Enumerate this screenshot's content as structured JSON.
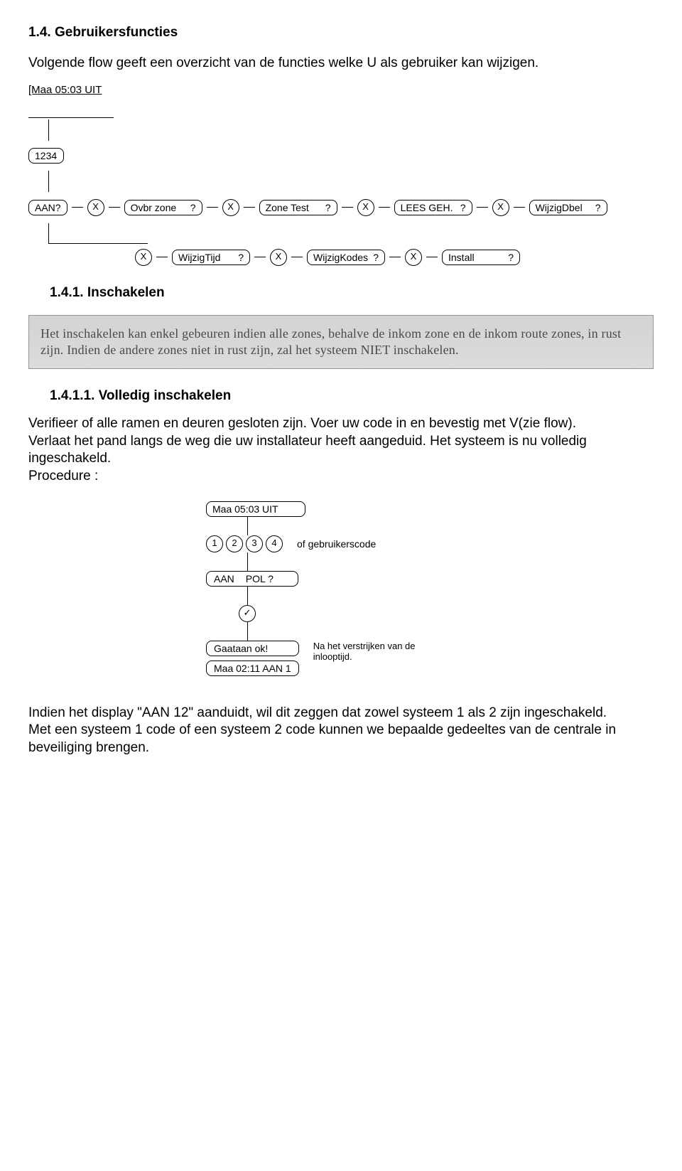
{
  "section": {
    "heading": "1.4. Gebruikersfuncties",
    "intro": "Volgende flow geeft een overzicht van de functies welke U als gebruiker kan wijzigen.",
    "status_line": "[Maa 05:03 UIT",
    "diagram1": {
      "code_box": "1234",
      "row1": [
        {
          "type": "pill",
          "label": "AAN?",
          "q": ""
        },
        {
          "type": "key",
          "label": "X"
        },
        {
          "type": "pill",
          "label": "Ovbr  zone",
          "q": "?"
        },
        {
          "type": "key",
          "label": "X"
        },
        {
          "type": "pill",
          "label": "Zone Test",
          "q": "?"
        },
        {
          "type": "key",
          "label": "X"
        },
        {
          "type": "pill",
          "label": "LEES GEH.",
          "q": "?"
        },
        {
          "type": "key",
          "label": "X"
        },
        {
          "type": "pill",
          "label": "WijzigDbel",
          "q": "?"
        }
      ],
      "row2": [
        {
          "type": "key",
          "label": "X"
        },
        {
          "type": "pill",
          "label": "WijzigTijd",
          "q": "?"
        },
        {
          "type": "key",
          "label": "X"
        },
        {
          "type": "pill",
          "label": "WijzigKodes",
          "q": "?"
        },
        {
          "type": "key",
          "label": "X"
        },
        {
          "type": "pill",
          "label": "Install",
          "q": "?"
        }
      ]
    },
    "sub1": {
      "heading": "1.4.1. Inschakelen",
      "greybox": "Het inschakelen kan enkel gebeuren indien alle zones, behalve de inkom zone en de inkom route zones, in rust zijn. Indien de andere zones niet in rust zijn, zal het systeem NIET inschakelen.",
      "sub": {
        "heading": "1.4.1.1. Volledig inschakelen",
        "para": "Verifieer of alle ramen en deuren gesloten zijn. Voer uw code in en bevestig met V(zie flow).\nVerlaat het pand langs de weg die uw installateur heeft aangeduid. Het systeem is nu volledig ingeschakeld.\nProcedure :"
      }
    },
    "procedure": {
      "start": "Maa 05:03 UIT",
      "keys": [
        "1",
        "2",
        "3",
        "4"
      ],
      "keys_caption": "of gebruikerscode",
      "step_aan": {
        "left": "AAN",
        "right": "POL ?"
      },
      "confirm_key": "✓",
      "step_gaat": "Gaataan    ok!",
      "step_final": "Maa 02:11 AAN 1",
      "final_caption": "Na het verstrijken van de inlooptijd."
    },
    "footer": "Indien het display \"AAN 12\" aanduidt, wil dit zeggen dat zowel systeem 1 als 2 zijn ingeschakeld.\nMet een systeem 1 code of een systeem 2 code kunnen we bepaalde gedeeltes van de centrale in beveiliging brengen."
  }
}
